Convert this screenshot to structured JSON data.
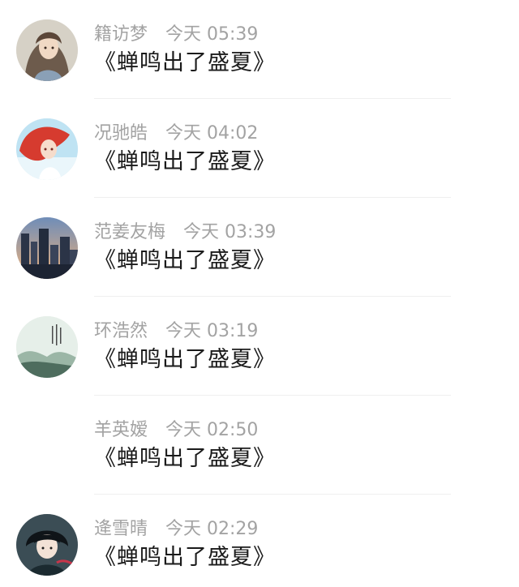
{
  "feed": {
    "items": [
      {
        "name": "籍访梦",
        "time": "今天 05:39",
        "title": "《蝉鸣出了盛夏》",
        "avatar": "avatar-anime-girl-icon"
      },
      {
        "name": "况驰皓",
        "time": "今天 04:02",
        "title": "《蝉鸣出了盛夏》",
        "avatar": "avatar-red-hair-girl-icon"
      },
      {
        "name": "范姜友梅",
        "time": "今天 03:39",
        "title": "《蝉鸣出了盛夏》",
        "avatar": "avatar-city-skyline-icon"
      },
      {
        "name": "环浩然",
        "time": "今天 03:19",
        "title": "《蝉鸣出了盛夏》",
        "avatar": "avatar-ink-landscape-icon"
      },
      {
        "name": "羊英嫒",
        "time": "今天 02:50",
        "title": "《蝉鸣出了盛夏》",
        "avatar": ""
      },
      {
        "name": "逄雪晴",
        "time": "今天 02:29",
        "title": "《蝉鸣出了盛夏》",
        "avatar": "avatar-dark-hair-boy-icon"
      }
    ]
  }
}
